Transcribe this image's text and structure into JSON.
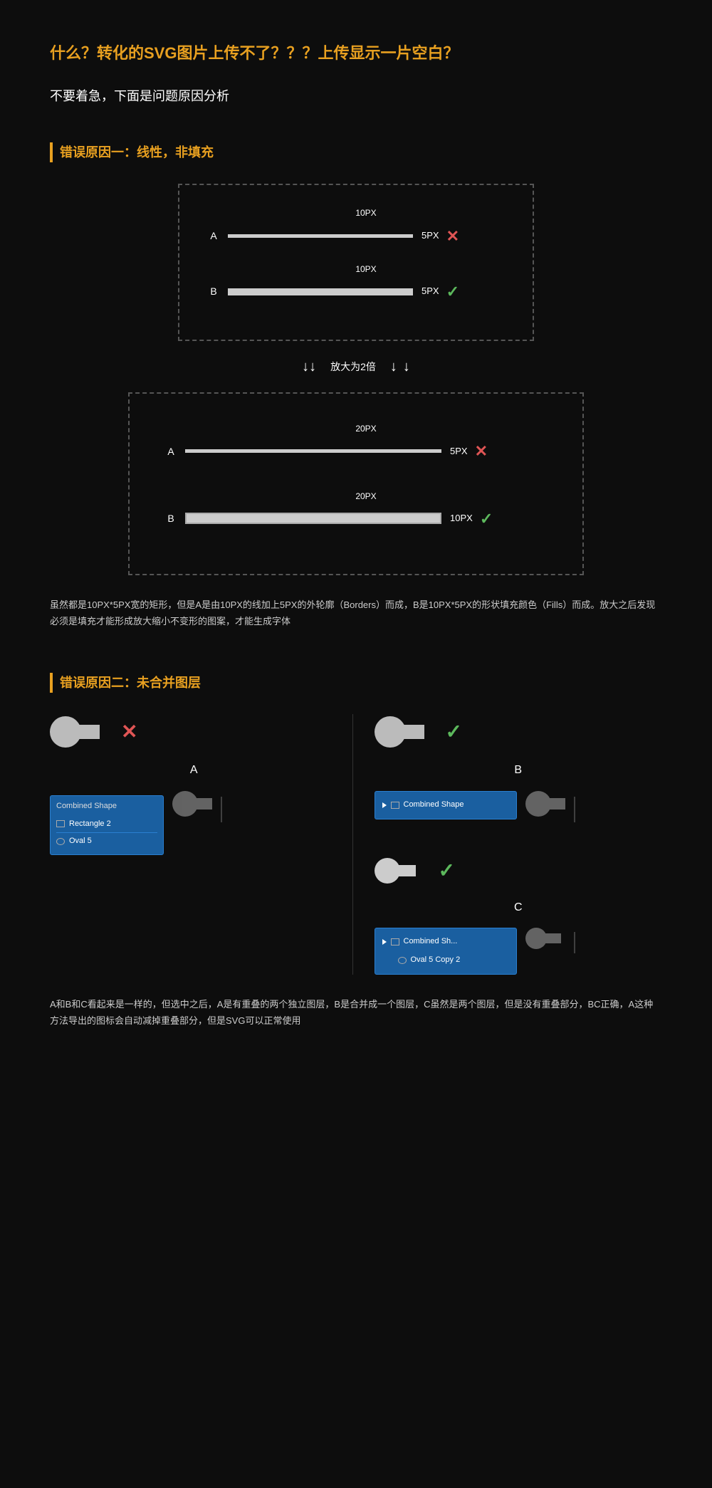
{
  "title": "什么？转化的SVG图片上传不了？？？上传显示一片空白？",
  "subtitle": "不要着急，下面是问题原因分析",
  "error1": {
    "section_title": "错误原因一：线性，非填充",
    "top_diagram": {
      "row_a": {
        "label": "A",
        "width_label": "10PX",
        "height_label": "5PX",
        "status": "×"
      },
      "row_b": {
        "label": "B",
        "width_label": "10PX",
        "height_label": "5PX",
        "status": "✓"
      }
    },
    "scale_label": "放大为2倍",
    "bottom_diagram": {
      "row_a": {
        "label": "A",
        "width_label": "20PX",
        "height_label": "5PX",
        "status": "×"
      },
      "row_b": {
        "label": "B",
        "width_label": "20PX",
        "height_label": "10PX",
        "status": "✓"
      }
    },
    "description": "虽然都是10PX*5PX宽的矩形，但是A是由10PX的线加上5PX的外轮廓（Borders）而成，B是10PX*5PX的形状填充颜色（Fills）而成。放大之后发现必须是填充才能形成放大缩小不变形的图案，才能生成字体"
  },
  "error2": {
    "section_title": "错误原因二：未合并图层",
    "left": {
      "label_a": "A",
      "status_a": "×",
      "layer_panel_title": "Combined Shape",
      "layers": [
        {
          "icon": "rect",
          "name": "Rectangle 2"
        },
        {
          "icon": "oval",
          "name": "Oval 5"
        }
      ]
    },
    "right": {
      "label_b": "B",
      "status_b": "✓",
      "combined_layer": "Combined Shape",
      "label_c": "C",
      "status_c": "✓",
      "combined_layer_c": "Combined Sh...",
      "oval_copy": "Oval 5 Copy 2"
    },
    "description": "A和B和C看起来是一样的，但选中之后，A是有重叠的两个独立图层，B是合并成一个图层，C虽然是两个图层，但是没有重叠部分，BC正确，A这种方法导出的图标会自动减掉重叠部分，但是SVG可以正常使用"
  }
}
